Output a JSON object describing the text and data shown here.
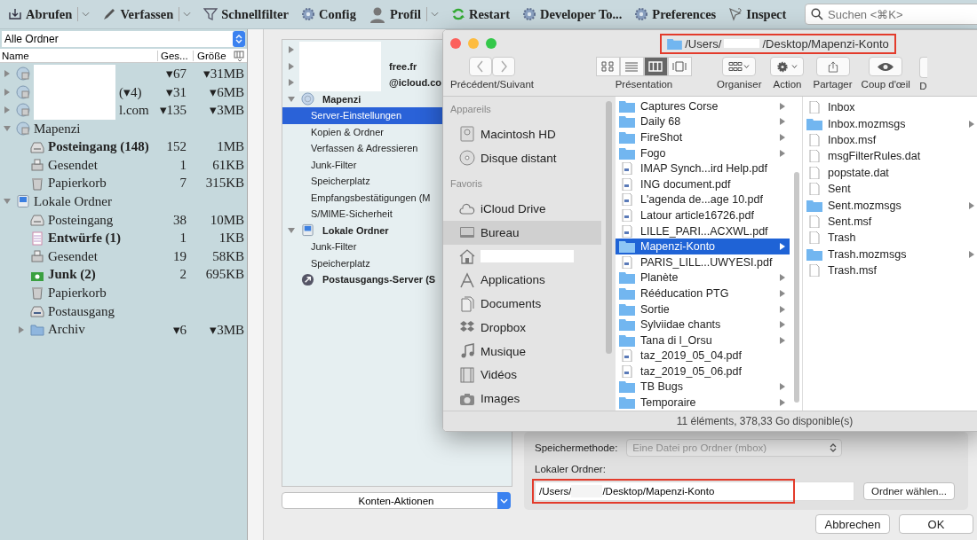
{
  "toolbar": {
    "buttons": [
      {
        "label": "Abrufen",
        "kind": "download",
        "has_menu": true
      },
      {
        "label": "Verfassen",
        "kind": "pen",
        "has_menu": true
      },
      {
        "label": "Schnellfilter",
        "kind": "filter",
        "has_menu": false
      },
      {
        "label": "Config",
        "kind": "gear",
        "has_menu": false
      },
      {
        "label": "Profil",
        "kind": "person",
        "has_menu": true
      },
      {
        "label": "Restart",
        "kind": "restart",
        "has_menu": false
      },
      {
        "label": "Developer To...",
        "kind": "gear",
        "has_menu": false
      },
      {
        "label": "Preferences",
        "kind": "gear",
        "has_menu": false
      },
      {
        "label": "Inspect",
        "kind": "cursor",
        "has_menu": false
      }
    ],
    "search": {
      "placeholder": "Suchen <⌘K>"
    }
  },
  "folder_pane": {
    "scope": "Alle Ordner",
    "columns": [
      "Name",
      "Ges...",
      "Größe"
    ],
    "folders": [
      {
        "kind": "account",
        "redacted": true,
        "expanded": false,
        "total": "▾67",
        "size": "▾31MB"
      },
      {
        "name": "(▾4)",
        "kind": "account",
        "redacted": true,
        "expanded": false,
        "total": "▾31",
        "size": "▾6MB"
      },
      {
        "name": "l.com",
        "kind": "account",
        "redacted": true,
        "expanded": false,
        "total": "▾135",
        "size": "▾3MB"
      },
      {
        "name": "Mapenzi",
        "kind": "account",
        "expanded": true,
        "children": [
          {
            "name": "Posteingang (148)",
            "kind": "inbox",
            "unread": true,
            "total": "152",
            "size": "1MB"
          },
          {
            "name": "Gesendet",
            "kind": "sent",
            "unread": false,
            "total": "1",
            "size": "61KB"
          },
          {
            "name": "Papierkorb",
            "kind": "trash",
            "unread": false,
            "total": "7",
            "size": "315KB"
          }
        ]
      },
      {
        "name": "Lokale Ordner",
        "kind": "local",
        "expanded": true,
        "children": [
          {
            "name": "Posteingang",
            "kind": "inbox",
            "unread": false,
            "total": "38",
            "size": "10MB"
          },
          {
            "name": "Entwürfe (1)",
            "kind": "drafts",
            "unread": true,
            "total": "1",
            "size": "1KB"
          },
          {
            "name": "Gesendet",
            "kind": "sent",
            "unread": false,
            "total": "19",
            "size": "58KB"
          },
          {
            "name": "Junk (2)",
            "kind": "junk",
            "unread": true,
            "total": "2",
            "size": "695KB"
          },
          {
            "name": "Papierkorb",
            "kind": "trash",
            "unread": false
          },
          {
            "name": "Postausgang",
            "kind": "outbox",
            "unread": false
          },
          {
            "name": "Archiv",
            "kind": "folder",
            "expanded": false,
            "unread": false,
            "total": "▾6",
            "size": "▾3MB"
          }
        ]
      }
    ]
  },
  "account_settings": {
    "accounts": [
      {
        "kind": "none",
        "redacted": true,
        "expanded": false,
        "selected": false
      },
      {
        "label": "free.fr",
        "kind": "none",
        "redacted": true,
        "expanded": false,
        "selected": false
      },
      {
        "label": "@icloud.co",
        "kind": "none",
        "redacted": true,
        "expanded": false,
        "selected": false
      },
      {
        "label": "Mapenzi",
        "kind": "account",
        "expanded": true,
        "selected": false,
        "children": [
          {
            "label": "Server-Einstellungen",
            "selected": true
          },
          {
            "label": "Kopien & Ordner",
            "selected": false
          },
          {
            "label": "Verfassen & Adressieren",
            "selected": false
          },
          {
            "label": "Junk-Filter",
            "selected": false
          },
          {
            "label": "Speicherplatz",
            "selected": false
          },
          {
            "label": "Empfangsbestätigungen (M",
            "selected": false
          },
          {
            "label": "S/MIME-Sicherheit",
            "selected": false
          }
        ]
      },
      {
        "label": "Lokale Ordner",
        "kind": "local",
        "expanded": true,
        "selected": false,
        "children": [
          {
            "label": "Junk-Filter",
            "selected": false
          },
          {
            "label": "Speicherplatz",
            "selected": false
          }
        ]
      },
      {
        "label": "Postausgangs-Server (S",
        "kind": "smtp",
        "selected": false
      }
    ],
    "account_actions": "Konten-Aktionen",
    "storage": {
      "label": "Speichermethode:",
      "value": "Eine Datei pro Ordner (mbox)",
      "disabled": true
    },
    "local_folder": {
      "label": "Lokaler Ordner:",
      "path_start": "/Users/",
      "path_end": "/Desktop/Mapenzi-Konto",
      "highlighted": true
    },
    "browse_button": "Ordner wählen...",
    "buttons": [
      "Abbrechen",
      "OK"
    ]
  },
  "finder": {
    "title": {
      "path_start": "/Users/",
      "path_end": "/Desktop/Mapenzi-Konto",
      "highlighted": true
    },
    "nav_label": "Précédent/Suivant",
    "views": [
      {
        "kind": "icons",
        "selected": false
      },
      {
        "kind": "list",
        "selected": false
      },
      {
        "kind": "columns",
        "selected": true
      },
      {
        "kind": "coverflow",
        "selected": false
      }
    ],
    "view_label": "Présentation",
    "tools": [
      {
        "label": "Organiser",
        "kind": "arrange"
      },
      {
        "label": "Action",
        "kind": "gear"
      },
      {
        "label": "Partager",
        "kind": "share"
      },
      {
        "label": "Coup d'œil",
        "kind": "eye"
      },
      {
        "label": "D",
        "kind": "cut"
      }
    ],
    "sidebar": [
      {
        "heading": "Appareils",
        "items": [
          {
            "label": "Macintosh HD",
            "kind": "disk",
            "selected": false
          },
          {
            "label": "Disque distant",
            "kind": "disc",
            "selected": false
          }
        ]
      },
      {
        "heading": "Favoris",
        "items": [
          {
            "label": "iCloud Drive",
            "kind": "cloud",
            "selected": false
          },
          {
            "label": "Bureau",
            "kind": "desktop",
            "selected": true
          },
          {
            "kind": "home",
            "redacted": true,
            "selected": false
          },
          {
            "label": "Applications",
            "kind": "apps",
            "selected": false
          },
          {
            "label": "Documents",
            "kind": "docs",
            "selected": false
          },
          {
            "label": "Dropbox",
            "kind": "dropbox",
            "selected": false
          },
          {
            "label": "Musique",
            "kind": "music",
            "selected": false
          },
          {
            "label": "Vidéos",
            "kind": "film",
            "selected": false
          },
          {
            "label": "Images",
            "kind": "camera",
            "selected": false
          }
        ]
      }
    ],
    "columns": [
      [
        {
          "name": "Captures Corse",
          "kind": "folder",
          "selected": false
        },
        {
          "name": "Daily 68",
          "kind": "folder",
          "selected": false
        },
        {
          "name": "FireShot",
          "kind": "folder",
          "selected": false
        },
        {
          "name": "Fogo",
          "kind": "folder",
          "selected": false
        },
        {
          "name": "IMAP Synch...ird Help.pdf",
          "kind": "pdf",
          "selected": false
        },
        {
          "name": "ING document.pdf",
          "kind": "pdf",
          "selected": false
        },
        {
          "name": "L'agenda de...age 10.pdf",
          "kind": "pdf",
          "selected": false
        },
        {
          "name": "Latour article16726.pdf",
          "kind": "pdf",
          "selected": false
        },
        {
          "name": "LILLE_PARI...ACXWL.pdf",
          "kind": "pdf",
          "selected": false
        },
        {
          "name": "Mapenzi-Konto",
          "kind": "folder",
          "selected": true
        },
        {
          "name": "PARIS_LILL...UWYESI.pdf",
          "kind": "pdf",
          "selected": false
        },
        {
          "name": "Planète",
          "kind": "folder",
          "selected": false
        },
        {
          "name": "Rééducation PTG",
          "kind": "folder",
          "selected": false
        },
        {
          "name": "Sortie",
          "kind": "folder",
          "selected": false
        },
        {
          "name": "Sylviidae chants",
          "kind": "folder",
          "selected": false
        },
        {
          "name": "Tana di l_Orsu",
          "kind": "folder",
          "selected": false
        },
        {
          "name": "taz_2019_05_04.pdf",
          "kind": "pdf",
          "selected": false
        },
        {
          "name": "taz_2019_05_06.pdf",
          "kind": "pdf",
          "selected": false
        },
        {
          "name": "TB Bugs",
          "kind": "folder",
          "selected": false
        },
        {
          "name": "Temporaire",
          "kind": "folder",
          "selected": false
        }
      ],
      [
        {
          "name": "Inbox",
          "kind": "file",
          "selected": false
        },
        {
          "name": "Inbox.mozmsgs",
          "kind": "folder",
          "selected": false
        },
        {
          "name": "Inbox.msf",
          "kind": "file",
          "selected": false
        },
        {
          "name": "msgFilterRules.dat",
          "kind": "file",
          "selected": false
        },
        {
          "name": "popstate.dat",
          "kind": "file",
          "selected": false
        },
        {
          "name": "Sent",
          "kind": "file",
          "selected": false
        },
        {
          "name": "Sent.mozmsgs",
          "kind": "folder",
          "selected": false
        },
        {
          "name": "Sent.msf",
          "kind": "file",
          "selected": false
        },
        {
          "name": "Trash",
          "kind": "file",
          "selected": false
        },
        {
          "name": "Trash.mozmsgs",
          "kind": "folder",
          "selected": false
        },
        {
          "name": "Trash.msf",
          "kind": "file",
          "selected": false
        }
      ]
    ],
    "status": "11 éléments, 378,33 Go disponible(s)"
  }
}
